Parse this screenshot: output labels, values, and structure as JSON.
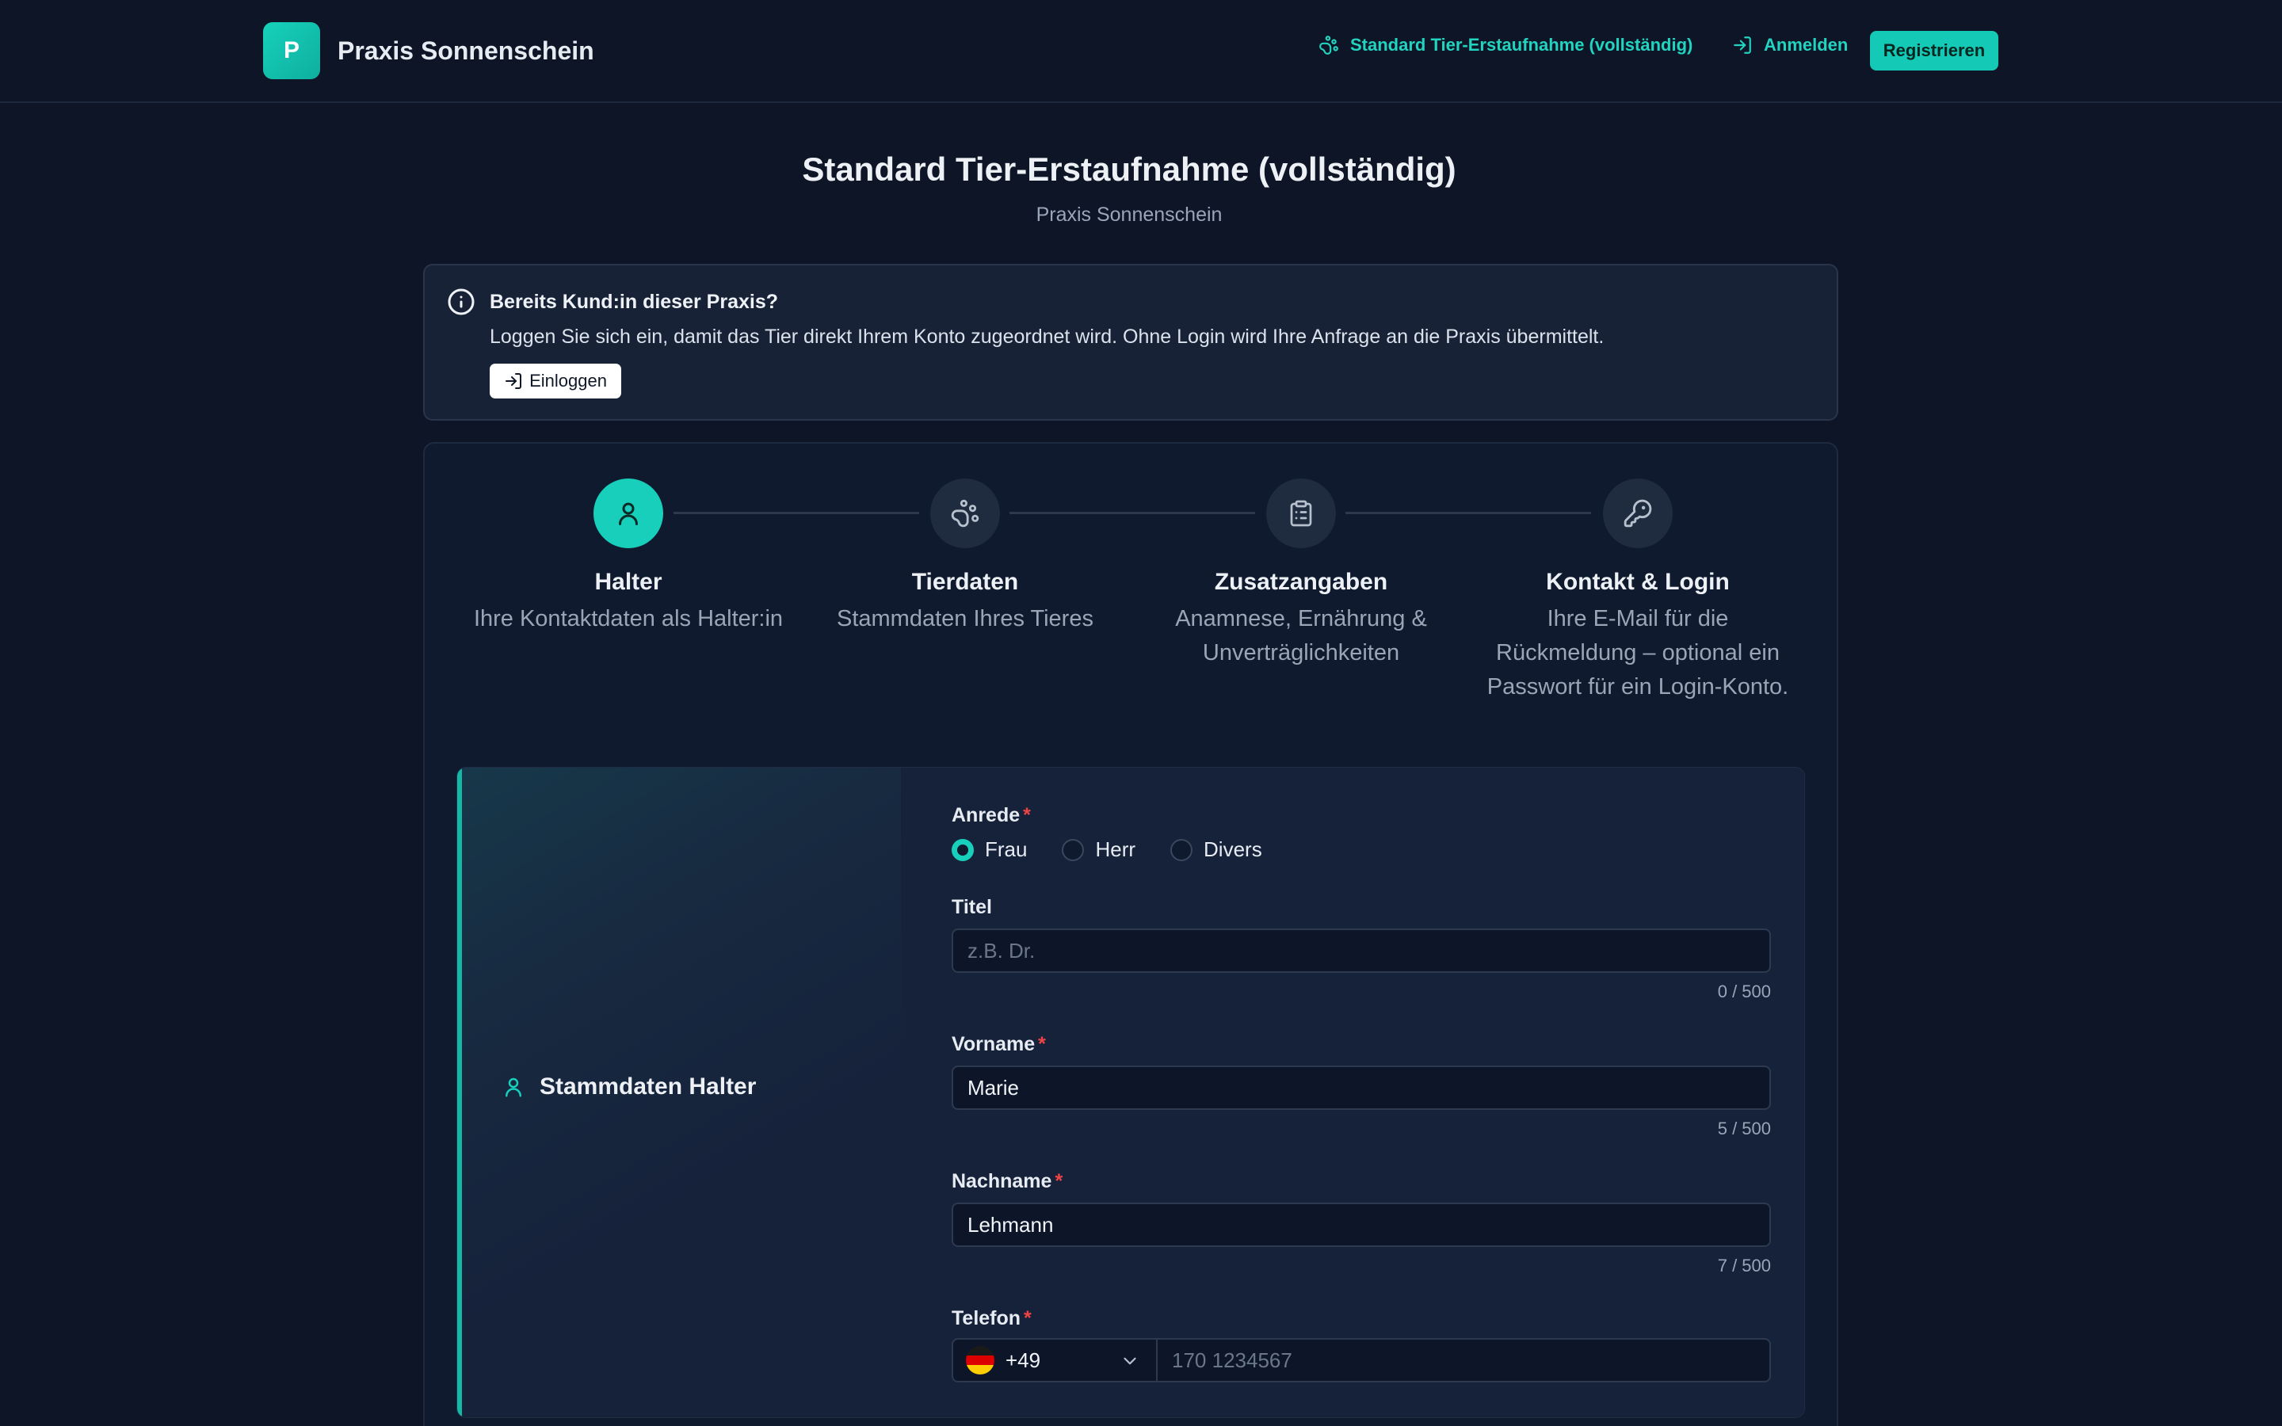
{
  "header": {
    "brand_letter": "P",
    "brand_name": "Praxis Sonnenschein",
    "form_link": "Standard Tier-Erstaufnahme (vollständig)",
    "login": "Anmelden",
    "register": "Registrieren"
  },
  "page": {
    "title": "Standard Tier-Erstaufnahme (vollständig)",
    "subtitle": "Praxis Sonnenschein"
  },
  "info": {
    "title": "Bereits Kund:in dieser Praxis?",
    "text": "Loggen Sie sich ein, damit das Tier direkt Ihrem Konto zugeordnet wird. Ohne Login wird Ihre Anfrage an die Praxis übermittelt.",
    "button": "Einloggen"
  },
  "steps": [
    {
      "title": "Halter",
      "desc": "Ihre Kontaktdaten als Halter:in",
      "icon": "user-icon",
      "active": true
    },
    {
      "title": "Tierdaten",
      "desc": "Stammdaten Ihres Tieres",
      "icon": "paw-icon",
      "active": false
    },
    {
      "title": "Zusatzangaben",
      "desc": "Anamnese, Ernährung & Unverträglichkeiten",
      "icon": "clipboard-icon",
      "active": false
    },
    {
      "title": "Kontakt & Login",
      "desc": "Ihre E-Mail für die Rückmeldung – optional ein Passwort für ein Login-Konto.",
      "icon": "key-icon",
      "active": false
    }
  ],
  "section": {
    "title": "Stammdaten Halter"
  },
  "form": {
    "salutation": {
      "label": "Anrede",
      "options": [
        "Frau",
        "Herr",
        "Divers"
      ],
      "selected": "Frau"
    },
    "title_field": {
      "label": "Titel",
      "placeholder": "z.B. Dr.",
      "value": "",
      "counter": "0 / 500"
    },
    "firstname": {
      "label": "Vorname",
      "value": "Marie",
      "counter": "5 / 500"
    },
    "lastname": {
      "label": "Nachname",
      "value": "Lehmann",
      "counter": "7 / 500"
    },
    "phone": {
      "label": "Telefon",
      "country_code": "+49",
      "placeholder": "170 1234567"
    }
  },
  "colors": {
    "accent": "#17cfbb",
    "background": "#0d1526",
    "required": "#ef4444"
  }
}
